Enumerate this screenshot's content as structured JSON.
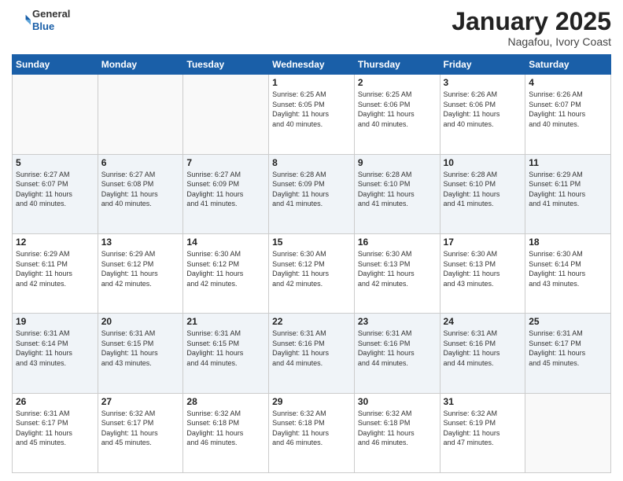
{
  "logo": {
    "general": "General",
    "blue": "Blue"
  },
  "title": "January 2025",
  "subtitle": "Nagafou, Ivory Coast",
  "days": [
    "Sunday",
    "Monday",
    "Tuesday",
    "Wednesday",
    "Thursday",
    "Friday",
    "Saturday"
  ],
  "weeks": [
    [
      {
        "num": "",
        "info": ""
      },
      {
        "num": "",
        "info": ""
      },
      {
        "num": "",
        "info": ""
      },
      {
        "num": "1",
        "info": "Sunrise: 6:25 AM\nSunset: 6:05 PM\nDaylight: 11 hours\nand 40 minutes."
      },
      {
        "num": "2",
        "info": "Sunrise: 6:25 AM\nSunset: 6:06 PM\nDaylight: 11 hours\nand 40 minutes."
      },
      {
        "num": "3",
        "info": "Sunrise: 6:26 AM\nSunset: 6:06 PM\nDaylight: 11 hours\nand 40 minutes."
      },
      {
        "num": "4",
        "info": "Sunrise: 6:26 AM\nSunset: 6:07 PM\nDaylight: 11 hours\nand 40 minutes."
      }
    ],
    [
      {
        "num": "5",
        "info": "Sunrise: 6:27 AM\nSunset: 6:07 PM\nDaylight: 11 hours\nand 40 minutes."
      },
      {
        "num": "6",
        "info": "Sunrise: 6:27 AM\nSunset: 6:08 PM\nDaylight: 11 hours\nand 40 minutes."
      },
      {
        "num": "7",
        "info": "Sunrise: 6:27 AM\nSunset: 6:09 PM\nDaylight: 11 hours\nand 41 minutes."
      },
      {
        "num": "8",
        "info": "Sunrise: 6:28 AM\nSunset: 6:09 PM\nDaylight: 11 hours\nand 41 minutes."
      },
      {
        "num": "9",
        "info": "Sunrise: 6:28 AM\nSunset: 6:10 PM\nDaylight: 11 hours\nand 41 minutes."
      },
      {
        "num": "10",
        "info": "Sunrise: 6:28 AM\nSunset: 6:10 PM\nDaylight: 11 hours\nand 41 minutes."
      },
      {
        "num": "11",
        "info": "Sunrise: 6:29 AM\nSunset: 6:11 PM\nDaylight: 11 hours\nand 41 minutes."
      }
    ],
    [
      {
        "num": "12",
        "info": "Sunrise: 6:29 AM\nSunset: 6:11 PM\nDaylight: 11 hours\nand 42 minutes."
      },
      {
        "num": "13",
        "info": "Sunrise: 6:29 AM\nSunset: 6:12 PM\nDaylight: 11 hours\nand 42 minutes."
      },
      {
        "num": "14",
        "info": "Sunrise: 6:30 AM\nSunset: 6:12 PM\nDaylight: 11 hours\nand 42 minutes."
      },
      {
        "num": "15",
        "info": "Sunrise: 6:30 AM\nSunset: 6:12 PM\nDaylight: 11 hours\nand 42 minutes."
      },
      {
        "num": "16",
        "info": "Sunrise: 6:30 AM\nSunset: 6:13 PM\nDaylight: 11 hours\nand 42 minutes."
      },
      {
        "num": "17",
        "info": "Sunrise: 6:30 AM\nSunset: 6:13 PM\nDaylight: 11 hours\nand 43 minutes."
      },
      {
        "num": "18",
        "info": "Sunrise: 6:30 AM\nSunset: 6:14 PM\nDaylight: 11 hours\nand 43 minutes."
      }
    ],
    [
      {
        "num": "19",
        "info": "Sunrise: 6:31 AM\nSunset: 6:14 PM\nDaylight: 11 hours\nand 43 minutes."
      },
      {
        "num": "20",
        "info": "Sunrise: 6:31 AM\nSunset: 6:15 PM\nDaylight: 11 hours\nand 43 minutes."
      },
      {
        "num": "21",
        "info": "Sunrise: 6:31 AM\nSunset: 6:15 PM\nDaylight: 11 hours\nand 44 minutes."
      },
      {
        "num": "22",
        "info": "Sunrise: 6:31 AM\nSunset: 6:16 PM\nDaylight: 11 hours\nand 44 minutes."
      },
      {
        "num": "23",
        "info": "Sunrise: 6:31 AM\nSunset: 6:16 PM\nDaylight: 11 hours\nand 44 minutes."
      },
      {
        "num": "24",
        "info": "Sunrise: 6:31 AM\nSunset: 6:16 PM\nDaylight: 11 hours\nand 44 minutes."
      },
      {
        "num": "25",
        "info": "Sunrise: 6:31 AM\nSunset: 6:17 PM\nDaylight: 11 hours\nand 45 minutes."
      }
    ],
    [
      {
        "num": "26",
        "info": "Sunrise: 6:31 AM\nSunset: 6:17 PM\nDaylight: 11 hours\nand 45 minutes."
      },
      {
        "num": "27",
        "info": "Sunrise: 6:32 AM\nSunset: 6:17 PM\nDaylight: 11 hours\nand 45 minutes."
      },
      {
        "num": "28",
        "info": "Sunrise: 6:32 AM\nSunset: 6:18 PM\nDaylight: 11 hours\nand 46 minutes."
      },
      {
        "num": "29",
        "info": "Sunrise: 6:32 AM\nSunset: 6:18 PM\nDaylight: 11 hours\nand 46 minutes."
      },
      {
        "num": "30",
        "info": "Sunrise: 6:32 AM\nSunset: 6:18 PM\nDaylight: 11 hours\nand 46 minutes."
      },
      {
        "num": "31",
        "info": "Sunrise: 6:32 AM\nSunset: 6:19 PM\nDaylight: 11 hours\nand 47 minutes."
      },
      {
        "num": "",
        "info": ""
      }
    ]
  ]
}
